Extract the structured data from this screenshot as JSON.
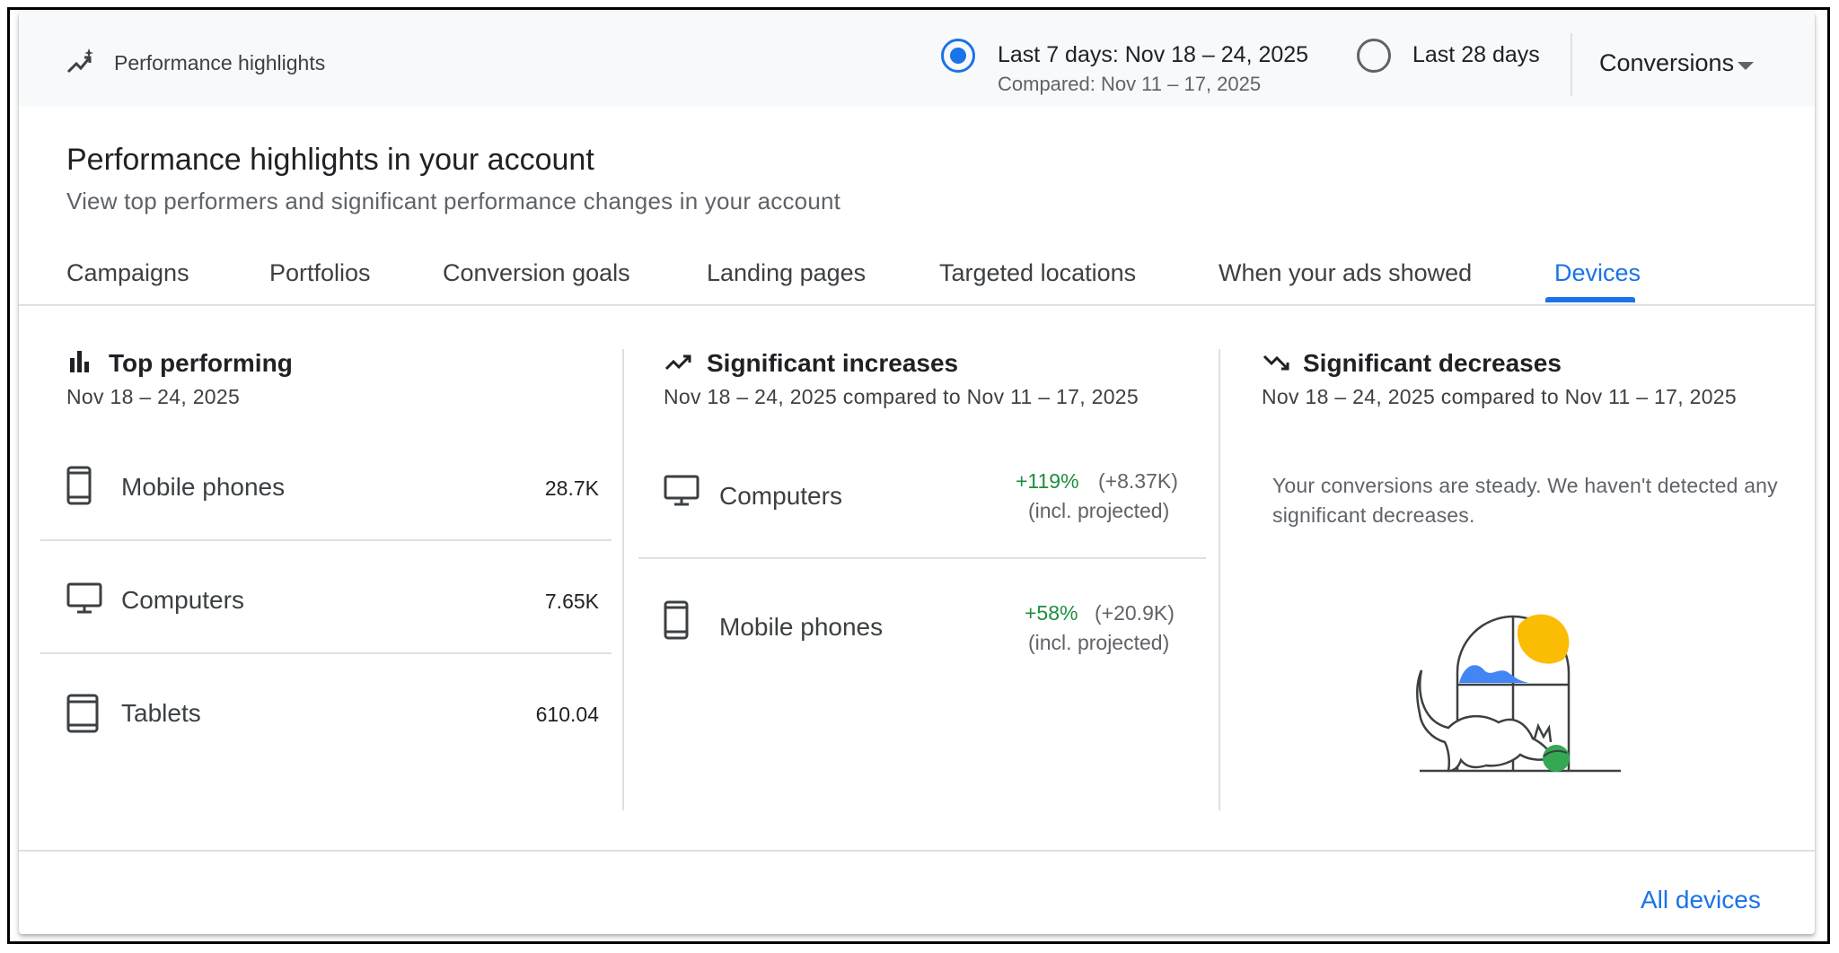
{
  "header": {
    "title": "Performance highlights",
    "range_7": {
      "label": "Last 7 days: Nov 18 – 24, 2025",
      "compared": "Compared: Nov 11 – 17, 2025",
      "selected": true
    },
    "range_28": {
      "label": "Last 28 days",
      "selected": false
    },
    "metric": "Conversions"
  },
  "page": {
    "title": "Performance highlights in your account",
    "subtitle": "View top performers and significant performance changes in your account"
  },
  "tabs": [
    {
      "label": "Campaigns"
    },
    {
      "label": "Portfolios"
    },
    {
      "label": "Conversion goals"
    },
    {
      "label": "Landing pages"
    },
    {
      "label": "Targeted locations"
    },
    {
      "label": "When your ads showed"
    },
    {
      "label": "Devices",
      "active": true
    }
  ],
  "top_performing": {
    "title": "Top performing",
    "date": "Nov 18 – 24, 2025",
    "rows": [
      {
        "icon": "mobile-phone-icon",
        "label": "Mobile phones",
        "value": "28.7K"
      },
      {
        "icon": "computer-icon",
        "label": "Computers",
        "value": "7.65K"
      },
      {
        "icon": "tablet-icon",
        "label": "Tablets",
        "value": "610.04"
      }
    ]
  },
  "increases": {
    "title": "Significant increases",
    "date": "Nov 18 – 24, 2025 compared to Nov 11 – 17, 2025",
    "rows": [
      {
        "icon": "computer-icon",
        "label": "Computers",
        "pct": "+119%",
        "abs": "(+8.37K)",
        "note": "(incl. projected)"
      },
      {
        "icon": "mobile-phone-icon",
        "label": "Mobile phones",
        "pct": "+58%",
        "abs": "(+20.9K)",
        "note": "(incl. projected)"
      }
    ]
  },
  "decreases": {
    "title": "Significant decreases",
    "date": "Nov 18 – 24, 2025 compared to Nov 11 – 17, 2025",
    "message": "Your conversions are steady. We haven't detected any significant decreases."
  },
  "footer": {
    "link": "All devices"
  },
  "colors": {
    "accent": "#1a73e8",
    "positive": "#1e8e3e",
    "illustration_sun": "#fbbc04",
    "illustration_wave": "#4285f4",
    "illustration_ball": "#34a853"
  }
}
